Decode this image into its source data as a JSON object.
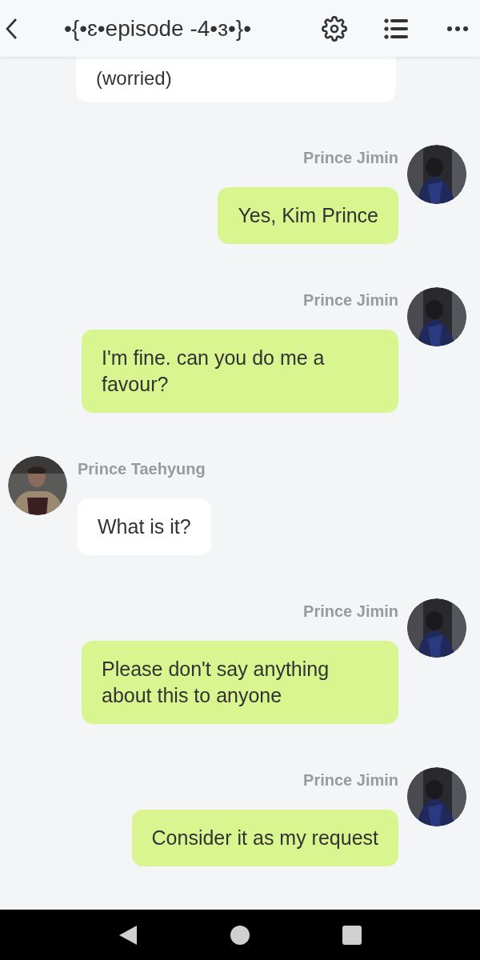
{
  "header": {
    "title": "•{•ɛ•episode -4•ɜ•}•"
  },
  "messages": [
    {
      "kind": "partial",
      "text": "(worried)"
    },
    {
      "kind": "sent",
      "sender": "Prince Jimin",
      "text": "Yes, Kim Prince"
    },
    {
      "kind": "sent",
      "sender": "Prince Jimin",
      "text": "I'm fine. can you do me a favour?"
    },
    {
      "kind": "received",
      "sender": "Prince Taehyung",
      "text": "What is it?"
    },
    {
      "kind": "sent",
      "sender": "Prince Jimin",
      "text": "Please don't say anything about this to anyone"
    },
    {
      "kind": "sent",
      "sender": "Prince Jimin",
      "text": "Consider it as my request"
    }
  ]
}
